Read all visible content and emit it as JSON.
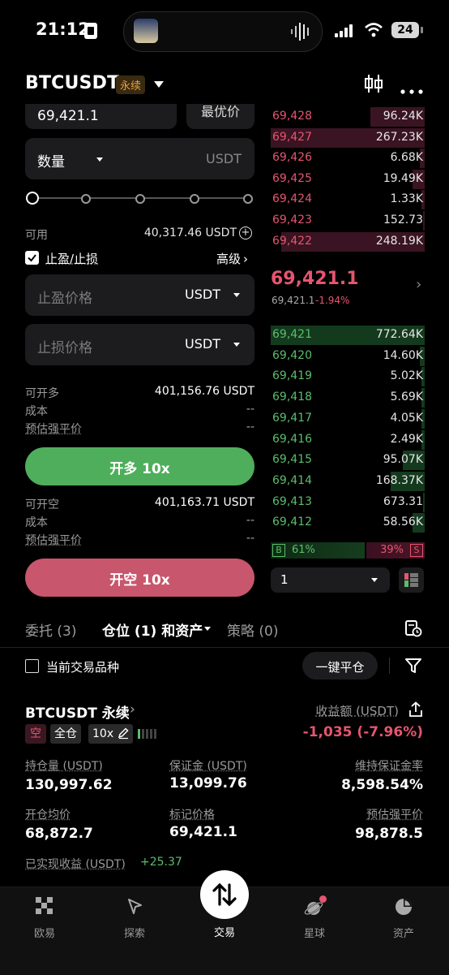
{
  "status_bar": {
    "time": "21:12",
    "battery": "24"
  },
  "header": {
    "symbol": "BTCUSDT",
    "badge": "永续"
  },
  "order_form": {
    "price_value": "69,421.1",
    "price_type": "最优价",
    "quantity_label": "数量",
    "quantity_unit": "USDT",
    "available_label": "可用",
    "available_value": "40,317.46 USDT",
    "tpsl_label": "止盈/止损",
    "advanced_label": "高级",
    "tp_placeholder": "止盈价格",
    "tp_unit": "USDT",
    "sl_placeholder": "止损价格",
    "sl_unit": "USDT",
    "long": {
      "can_open_label": "可开多",
      "can_open_value": "401,156.76 USDT",
      "cost_label": "成本",
      "cost_value": "--",
      "liq_label": "预估强平价",
      "liq_value": "--",
      "button": "开多 10x"
    },
    "short": {
      "can_open_label": "可开空",
      "can_open_value": "401,163.71 USDT",
      "cost_label": "成本",
      "cost_value": "--",
      "liq_label": "预估强平价",
      "liq_value": "--",
      "button": "开空 10x"
    }
  },
  "order_book": {
    "asks": [
      {
        "price": "69,428",
        "qty": "96.24K",
        "depth": 0.35
      },
      {
        "price": "69,427",
        "qty": "267.23K",
        "depth": 1.0
      },
      {
        "price": "69,426",
        "qty": "6.68K",
        "depth": 0.03
      },
      {
        "price": "69,425",
        "qty": "19.49K",
        "depth": 0.08
      },
      {
        "price": "69,424",
        "qty": "1.33K",
        "depth": 0.02
      },
      {
        "price": "69,423",
        "qty": "152.73",
        "depth": 0.01
      },
      {
        "price": "69,422",
        "qty": "248.19K",
        "depth": 0.93
      }
    ],
    "last_price": "69,421.1",
    "mark_price": "69,421.1",
    "change": "-1.94%",
    "bids": [
      {
        "price": "69,421",
        "qty": "772.64K",
        "depth": 1.0
      },
      {
        "price": "69,420",
        "qty": "14.60K",
        "depth": 0.03
      },
      {
        "price": "69,419",
        "qty": "5.02K",
        "depth": 0.02
      },
      {
        "price": "69,418",
        "qty": "5.69K",
        "depth": 0.02
      },
      {
        "price": "69,417",
        "qty": "4.05K",
        "depth": 0.02
      },
      {
        "price": "69,416",
        "qty": "2.49K",
        "depth": 0.02
      },
      {
        "price": "69,415",
        "qty": "95.07K",
        "depth": 0.14
      },
      {
        "price": "69,414",
        "qty": "168.37K",
        "depth": 0.22
      },
      {
        "price": "69,413",
        "qty": "673.31",
        "depth": 0.01
      },
      {
        "price": "69,412",
        "qty": "58.56K",
        "depth": 0.08
      }
    ],
    "buy_ratio_label": "B",
    "buy_ratio": "61%",
    "sell_ratio": "39%",
    "sell_ratio_label": "S",
    "precision": "1"
  },
  "tabs": {
    "orders": "委托 (3)",
    "positions": "仓位 (1) 和资产",
    "strategy": "策略 (0)"
  },
  "filter": {
    "current_pair": "当前交易品种",
    "close_all": "一键平仓"
  },
  "position": {
    "symbol": "BTCUSDT 永续",
    "side": "空",
    "margin_mode": "全仓",
    "leverage": "10x",
    "pnl_label": "收益额 (USDT)",
    "pnl_value": "-1,035 (-7.96%)",
    "size_label": "持仓量 (USDT)",
    "size_value": "130,997.62",
    "margin_label": "保证金 (USDT)",
    "margin_value": "13,099.76",
    "mmr_label": "维持保证金率",
    "mmr_value": "8,598.54%",
    "entry_label": "开仓均价",
    "entry_value": "68,872.7",
    "mark_label": "标记价格",
    "mark_value": "69,421.1",
    "liq_label": "预估强平价",
    "liq_value": "98,878.5",
    "realized_label": "已实现收益 (USDT)",
    "realized_value": "+25.37"
  },
  "nav": {
    "home": "欧易",
    "discover": "探索",
    "trade": "交易",
    "planet": "星球",
    "assets": "资产"
  },
  "colors": {
    "green": "#5bbd6b",
    "red": "#e6556f",
    "accent_orange": "#e3a24a"
  }
}
